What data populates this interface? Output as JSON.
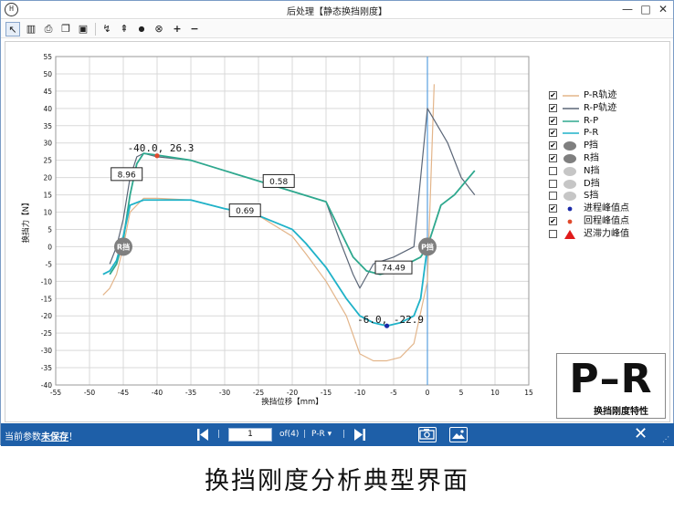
{
  "window": {
    "title": "后处理【静态换挡刚度】",
    "app_icon_text": "H",
    "minimize": "—",
    "maximize": "□",
    "close": "✕"
  },
  "toolbar": {
    "buttons": [
      {
        "name": "pointer-tool",
        "icon": "arrow-cursor-icon",
        "glyph": "↖"
      },
      {
        "name": "filter-tool",
        "icon": "bars-icon",
        "glyph": "▥"
      },
      {
        "name": "print-tool",
        "icon": "printer-icon",
        "glyph": "⎙"
      },
      {
        "name": "copy-tool",
        "icon": "copy-icon",
        "glyph": "❐"
      },
      {
        "name": "save-tool",
        "icon": "floppy-icon",
        "glyph": "▣"
      },
      {
        "name": "curve-tool",
        "icon": "curve-cursor-icon",
        "glyph": "↯"
      },
      {
        "name": "peak-tool",
        "icon": "peak-cursor-icon",
        "glyph": "⇞"
      },
      {
        "name": "point-tool",
        "icon": "dot-icon",
        "glyph": "●"
      },
      {
        "name": "delete-point-tool",
        "icon": "circle-x-icon",
        "glyph": "⊗"
      },
      {
        "name": "add-tool",
        "icon": "plus-icon",
        "glyph": "+"
      },
      {
        "name": "remove-tool",
        "icon": "minus-icon",
        "glyph": "−"
      }
    ]
  },
  "chart_data": {
    "type": "line",
    "xlabel": "换挡位移【mm】",
    "ylabel": "换挡力【N】",
    "xlim": [
      -55,
      15
    ],
    "ylim": [
      -40,
      55
    ],
    "xticks": [
      -55,
      -50,
      -45,
      -40,
      -35,
      -30,
      -25,
      -20,
      -15,
      -10,
      -5,
      0,
      5,
      10,
      15
    ],
    "yticks": [
      -40,
      -35,
      -30,
      -25,
      -20,
      -15,
      -10,
      -5,
      0,
      5,
      10,
      15,
      20,
      25,
      30,
      35,
      40,
      45,
      50,
      55
    ],
    "grid": true,
    "series": [
      {
        "name": "P-R轨迹",
        "color": "#e3b58a",
        "x": [
          -48,
          -47,
          -46,
          -45,
          -44,
          -42,
          -40,
          -35,
          -30,
          -25,
          -20,
          -18,
          -15,
          -12,
          -10,
          -8,
          -6,
          -4,
          -2,
          0,
          1
        ],
        "y": [
          -14,
          -12,
          -8,
          0,
          10,
          14,
          14,
          13.5,
          11,
          9,
          3,
          -2,
          -10,
          -20,
          -31,
          -33,
          -33,
          -32,
          -28,
          -10,
          47
        ]
      },
      {
        "name": "R-P轨迹",
        "color": "#5b6677",
        "x": [
          -47,
          -46,
          -45,
          -44,
          -43,
          -42,
          -40,
          -35,
          -30,
          -25,
          -20,
          -15,
          -13,
          -11,
          -10,
          -8,
          -5,
          -2,
          0,
          3,
          5,
          7
        ],
        "y": [
          -5,
          0,
          8,
          20,
          26,
          27,
          26,
          25,
          22,
          19,
          16,
          13,
          2,
          -8,
          -12,
          -5,
          -3,
          0,
          40,
          30,
          20,
          15
        ]
      },
      {
        "name": "R-P",
        "color": "#2ea88e",
        "x": [
          -47,
          -46,
          -45,
          -44,
          -43,
          -42,
          -40,
          -35,
          -30,
          -25,
          -20,
          -15,
          -13,
          -11,
          -9,
          -7,
          -5,
          -3,
          -1,
          0,
          2,
          4,
          7
        ],
        "y": [
          -8,
          -5,
          2,
          15,
          24,
          27,
          26.5,
          25,
          22,
          19,
          16,
          13,
          5,
          -3,
          -7,
          -8,
          -7,
          -5,
          -3,
          0,
          12,
          15,
          22
        ]
      },
      {
        "name": "P-R",
        "color": "#1fb2c8",
        "x": [
          -48,
          -47,
          -46,
          -45,
          -44,
          -42,
          -40,
          -35,
          -30,
          -25,
          -20,
          -18,
          -15,
          -12,
          -10,
          -8,
          -6,
          -4,
          -2,
          -1,
          0
        ],
        "y": [
          -8,
          -7,
          -4,
          3,
          12,
          13.5,
          13.5,
          13.5,
          11,
          9,
          5,
          1,
          -6,
          -15,
          -20,
          -22,
          -22.9,
          -22,
          -20,
          -15,
          0
        ]
      }
    ],
    "legend": {
      "placement": "right",
      "entries": [
        {
          "label": "P-R轨迹",
          "checked": true,
          "kind": "line",
          "color": "#e3b58a"
        },
        {
          "label": "R-P轨迹",
          "checked": true,
          "kind": "line",
          "color": "#5b6677"
        },
        {
          "label": "R-P",
          "checked": true,
          "kind": "line",
          "color": "#2ea88e"
        },
        {
          "label": "P-R",
          "checked": true,
          "kind": "line",
          "color": "#1fb2c8"
        },
        {
          "label": "P挡",
          "checked": true,
          "kind": "ellipse",
          "color": "#7f7f7f"
        },
        {
          "label": "R挡",
          "checked": true,
          "kind": "ellipse",
          "color": "#7f7f7f"
        },
        {
          "label": "N挡",
          "checked": false,
          "kind": "ellipse",
          "color": "#c6c6c6"
        },
        {
          "label": "D挡",
          "checked": false,
          "kind": "ellipse",
          "color": "#c6c6c6"
        },
        {
          "label": "S挡",
          "checked": false,
          "kind": "ellipse",
          "color": "#c6c6c6"
        },
        {
          "label": "进程峰值点",
          "checked": true,
          "kind": "dot",
          "color": "#1b2aa8"
        },
        {
          "label": "回程峰值点",
          "checked": true,
          "kind": "dot",
          "color": "#e04a2c"
        },
        {
          "label": "迟滞力峰值",
          "checked": false,
          "kind": "triangle",
          "color": "#e01b1b"
        }
      ]
    },
    "annotations": [
      {
        "kind": "peak-label",
        "text": "-40.0, 26.3",
        "x": -40,
        "y": 26.3
      },
      {
        "kind": "peak-label",
        "text": "-6.0, -22.9",
        "x": -6,
        "y": -22.9
      },
      {
        "kind": "stiffness-box",
        "text": "8.96",
        "x": -44.5,
        "y": 21
      },
      {
        "kind": "stiffness-box",
        "text": "0.58",
        "x": -22,
        "y": 19
      },
      {
        "kind": "stiffness-box",
        "text": "0.69",
        "x": -27,
        "y": 10.5
      },
      {
        "kind": "stiffness-box",
        "text": "74.49",
        "x": -5,
        "y": -6
      },
      {
        "kind": "gear-marker",
        "text": "R挡",
        "x": -45,
        "y": 0
      },
      {
        "kind": "gear-marker",
        "text": "P挡",
        "x": 0,
        "y": 0
      }
    ],
    "peaks": [
      {
        "name": "回程峰值点",
        "x": -40,
        "y": 26.3,
        "color": "#e04a2c"
      },
      {
        "name": "进程峰值点",
        "x": -6,
        "y": -22.9,
        "color": "#1b2aa8"
      }
    ]
  },
  "stamp": {
    "big": "P–R",
    "small": "换挡刚度特性"
  },
  "statusbar": {
    "message_prefix": "当前参数",
    "message_emphasis": "未保存",
    "message_suffix": "！",
    "page_value": "1",
    "page_of": "of(4)",
    "separator": "|",
    "selector_value": "P-R",
    "first_icon": "first-page-icon",
    "last_icon": "last-page-icon",
    "camera_icon": "camera-icon",
    "image_icon": "image-icon",
    "close_icon": "close-icon",
    "grip": "⋰"
  },
  "caption": "换挡刚度分析典型界面"
}
